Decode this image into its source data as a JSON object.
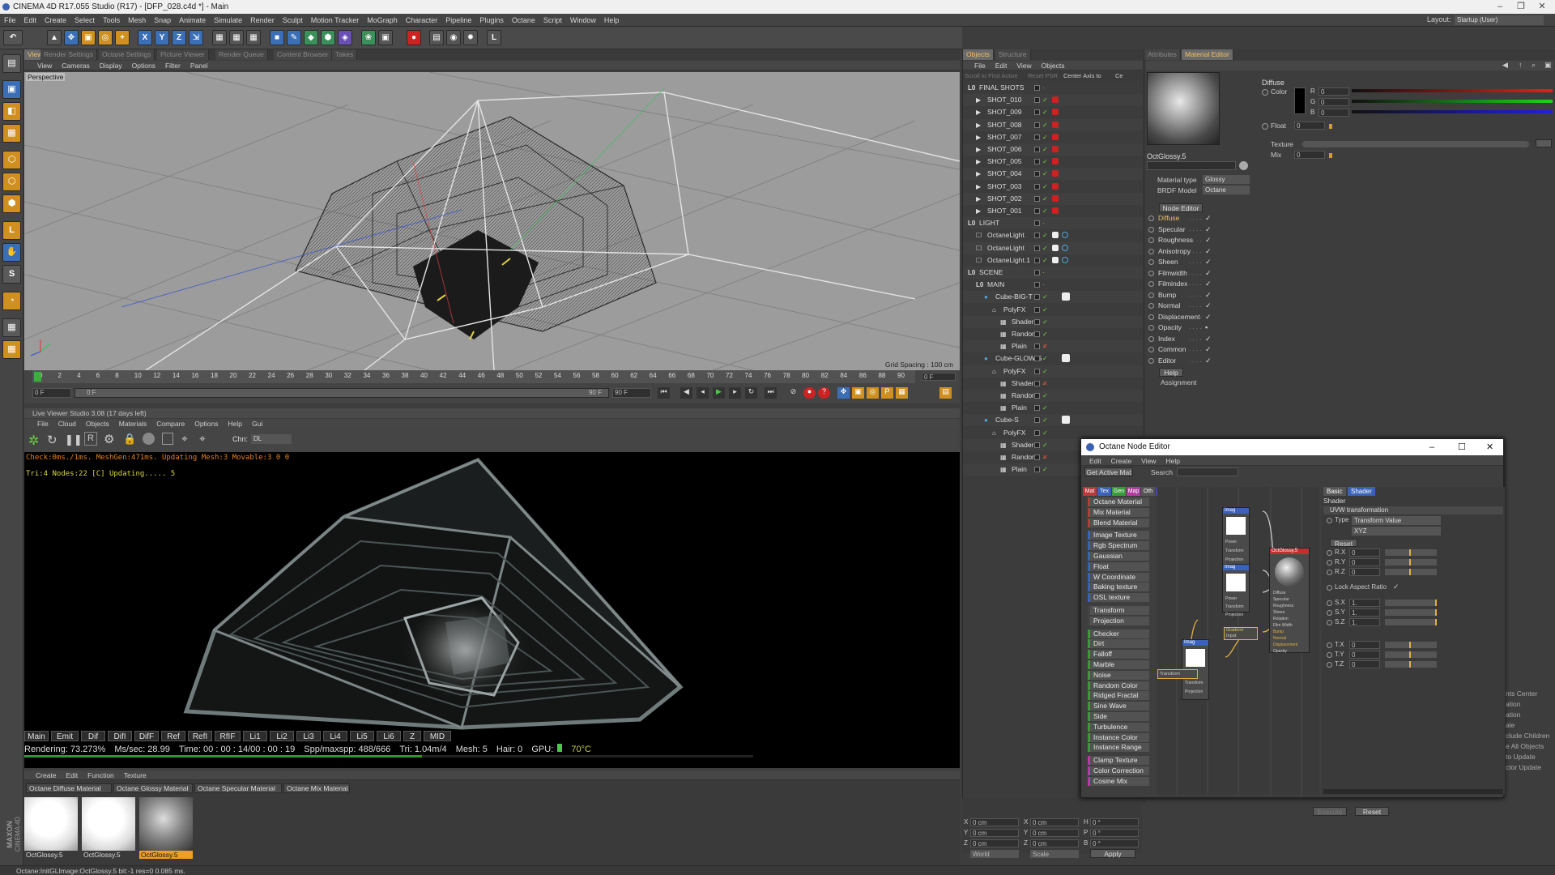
{
  "window": {
    "title": "CINEMA 4D R17.055 Studio (R17) - [DFP_028.c4d *] - Main",
    "layout_label": "Layout:",
    "layout_value": "Startup (User)"
  },
  "menu": [
    "File",
    "Edit",
    "Create",
    "Select",
    "Tools",
    "Mesh",
    "Snap",
    "Animate",
    "Simulate",
    "Render",
    "Sculpt",
    "Motion Tracker",
    "MoGraph",
    "Character",
    "Pipeline",
    "Plugins",
    "Octane",
    "Script",
    "Window",
    "Help"
  ],
  "toolbar": {
    "x_label": "X",
    "y_label": "Y",
    "z_label": "Z"
  },
  "editor_tabs": [
    "View",
    "Render Settings",
    "Octane Settings",
    "Picture Viewer",
    "Render Queue",
    "Content Browser",
    "Takes"
  ],
  "viewport": {
    "menu": [
      "View",
      "Cameras",
      "Display",
      "Options",
      "Filter",
      "Panel"
    ],
    "label": "Perspective",
    "grid_spacing": "Grid Spacing : 100 cm"
  },
  "timeline": {
    "ticks": [
      "0",
      "2",
      "4",
      "6",
      "8",
      "10",
      "12",
      "14",
      "16",
      "18",
      "20",
      "22",
      "24",
      "26",
      "28",
      "30",
      "32",
      "34",
      "36",
      "38",
      "40",
      "42",
      "44",
      "46",
      "48",
      "50",
      "52",
      "54",
      "56",
      "58",
      "60",
      "62",
      "64",
      "66",
      "68",
      "70",
      "72",
      "74",
      "76",
      "78",
      "80",
      "82",
      "84",
      "86",
      "88",
      "90"
    ],
    "current": "0 F",
    "start": "0 F",
    "end": "90 F",
    "end2": "90 F",
    "frame_right": "0 F",
    "slider_label": "0 F"
  },
  "live_viewer": {
    "title": "Live Viewer Studio 3.08 (17 days left)",
    "menu": [
      "File",
      "Cloud",
      "Objects",
      "Materials",
      "Compare",
      "Options",
      "Help",
      "Gui"
    ],
    "chn_label": "Chn:",
    "chn_value": "DL",
    "status1": "Check:0ms./1ms. MeshGen:471ms. Updating Mesh:3 Movable:3  0 0",
    "status2": "Tri:4 Nodes:22 [C] Updating.....   5",
    "passes": [
      "Main",
      "Emit",
      "Dif",
      "DifI",
      "DifF",
      "Ref",
      "RefI",
      "RfIF",
      "Li1",
      "Li2",
      "Li3",
      "Li4",
      "Li5",
      "Li6",
      "Z",
      "MID"
    ],
    "rendering": "Rendering: 73.273%",
    "ms_sec": "Ms/sec: 28.99",
    "time": "Time: 00 : 00 : 14/00 : 00 : 19",
    "spp": "Spp/maxspp: 488/666",
    "tri": "Tri: 1.04m/4",
    "mesh": "Mesh: 5",
    "hair": "Hair: 0",
    "gpu": "GPU:",
    "temp": "70°C",
    "progress": 73.273
  },
  "material_manager": {
    "menu": [
      "Create",
      "Edit",
      "Function",
      "Texture"
    ],
    "filters": [
      "Octane Diffuse Material",
      "Octane Glossy Material",
      "Octane Specular Material",
      "Octane Mix Material"
    ],
    "materials": [
      "OctGlossy.5",
      "OctGlossy.5",
      "OctGlossy.5"
    ]
  },
  "status_bar": "Octane:InitGLImage:OctGlossy.5  bit:-1 res=0  0.085 ms.",
  "maxon": {
    "line1": "MAXON",
    "line2": "CINEMA 4D"
  },
  "objects_panel": {
    "tabs": [
      "Objects",
      "Structure"
    ],
    "menu": [
      "File",
      "Edit",
      "View",
      "Objects"
    ],
    "sub_buttons": [
      "Scroll to First Active",
      "Reset PSR",
      "Center Axis to",
      "Ce"
    ],
    "items": [
      {
        "name": "FINAL SHOTS",
        "depth": 0,
        "type": "null"
      },
      {
        "name": "SHOT_010",
        "depth": 1,
        "type": "cam"
      },
      {
        "name": "SHOT_009",
        "depth": 1,
        "type": "cam"
      },
      {
        "name": "SHOT_008",
        "depth": 1,
        "type": "cam"
      },
      {
        "name": "SHOT_007",
        "depth": 1,
        "type": "cam"
      },
      {
        "name": "SHOT_006",
        "depth": 1,
        "type": "cam"
      },
      {
        "name": "SHOT_005",
        "depth": 1,
        "type": "cam"
      },
      {
        "name": "SHOT_004",
        "depth": 1,
        "type": "cam"
      },
      {
        "name": "SHOT_003",
        "depth": 1,
        "type": "cam"
      },
      {
        "name": "SHOT_002",
        "depth": 1,
        "type": "cam"
      },
      {
        "name": "SHOT_001",
        "depth": 1,
        "type": "cam"
      },
      {
        "name": "LIGHT",
        "depth": 0,
        "type": "null"
      },
      {
        "name": "OctaneLight",
        "depth": 1,
        "type": "light"
      },
      {
        "name": "OctaneLight",
        "depth": 1,
        "type": "light"
      },
      {
        "name": "OctaneLight.1",
        "depth": 1,
        "type": "light"
      },
      {
        "name": "SCENE",
        "depth": 0,
        "type": "null"
      },
      {
        "name": "MAIN",
        "depth": 1,
        "type": "null"
      },
      {
        "name": "Cube-BIG-T",
        "depth": 2,
        "type": "cube"
      },
      {
        "name": "PolyFX",
        "depth": 3,
        "type": "fx"
      },
      {
        "name": "Shader",
        "depth": 4,
        "type": "eff"
      },
      {
        "name": "Random",
        "depth": 4,
        "type": "eff"
      },
      {
        "name": "Plain",
        "depth": 4,
        "type": "eff"
      },
      {
        "name": "Cube-GLOW-S",
        "depth": 2,
        "type": "cube"
      },
      {
        "name": "PolyFX",
        "depth": 3,
        "type": "fx"
      },
      {
        "name": "Shader",
        "depth": 4,
        "type": "eff"
      },
      {
        "name": "Random",
        "depth": 4,
        "type": "eff"
      },
      {
        "name": "Plain",
        "depth": 4,
        "type": "eff"
      },
      {
        "name": "Cube-S",
        "depth": 2,
        "type": "cube"
      },
      {
        "name": "PolyFX",
        "depth": 3,
        "type": "fx"
      },
      {
        "name": "Shader",
        "depth": 4,
        "type": "eff"
      },
      {
        "name": "Random",
        "depth": 4,
        "type": "eff"
      },
      {
        "name": "Plain",
        "depth": 4,
        "type": "eff"
      }
    ]
  },
  "coordinates": {
    "labels": [
      "X",
      "Y",
      "Z",
      "X",
      "Y",
      "Z",
      "H",
      "P",
      "B"
    ],
    "values": [
      "0 cm",
      "0 cm",
      "0 cm",
      "0 cm",
      "0 cm",
      "0 cm",
      "0 °",
      "0 °",
      "0 °"
    ],
    "world": "World",
    "scale": "Scale",
    "apply": "Apply"
  },
  "attributes": {
    "tabs": [
      "Attributes",
      "Material Editor"
    ],
    "mat_name": "OctGlossy.5",
    "material_type_label": "Material type",
    "material_type": "Glossy",
    "brdf_label": "BRDF Model",
    "brdf": "Octane",
    "node_editor_btn": "Node Editor",
    "channels": [
      "Diffuse",
      "Specular",
      "Roughness",
      "Anisotropy",
      "Sheen",
      "Filmwidth",
      "Filmindex",
      "Bump",
      "Normal",
      "Displacement",
      "Opacity",
      "Index",
      "Common",
      "Editor"
    ],
    "help": "Help",
    "assignment": "Assignment",
    "section": "Diffuse",
    "color_label": "Color",
    "r_label": "R",
    "g_label": "G",
    "b_label": "B",
    "r_value": "0",
    "g_value": "0",
    "b_value": "0",
    "float_label": "Float",
    "float_value": "0",
    "texture_label": "Texture",
    "mix_label": "Mix",
    "mix_value": "0",
    "right_cut": [
      "nts Center",
      "ation",
      "ation",
      "ale",
      "clude Children",
      "e All Objects",
      "to Update",
      "ctor Update"
    ],
    "execute": "Execute",
    "reset": "Reset"
  },
  "node_editor": {
    "title": "Octane Node Editor",
    "menu": [
      "Edit",
      "Create",
      "View",
      "Help"
    ],
    "get_active": "Get Active Mat",
    "search_label": "Search",
    "cat_tabs": [
      "Mat",
      "Tex",
      "Gen",
      "Map",
      "Oth",
      "Ems",
      "Med",
      "C4D"
    ],
    "nodes": [
      {
        "name": "Octane Material",
        "color": "#b83a3a"
      },
      {
        "name": "Mix Material",
        "color": "#b83a3a"
      },
      {
        "name": "Blend Material",
        "color": "#b83a3a"
      },
      {
        "name": "Image Texture",
        "color": "#3a62b8"
      },
      {
        "name": "Rgb Spectrum",
        "color": "#3a62b8"
      },
      {
        "name": "Gaussian Spectrum",
        "color": "#3a62b8"
      },
      {
        "name": "Float",
        "color": "#3a62b8"
      },
      {
        "name": "W Coordinate",
        "color": "#3a62b8"
      },
      {
        "name": "Baking texture",
        "color": "#3a62b8"
      },
      {
        "name": "OSL texture",
        "color": "#3a62b8"
      },
      {
        "name": "Transform",
        "color": "#444444"
      },
      {
        "name": "Projection",
        "color": "#444444"
      },
      {
        "name": "Checker",
        "color": "#3a9a3a"
      },
      {
        "name": "Dirt",
        "color": "#3a9a3a"
      },
      {
        "name": "Falloff",
        "color": "#3a9a3a"
      },
      {
        "name": "Marble",
        "color": "#3a9a3a"
      },
      {
        "name": "Noise",
        "color": "#3a9a3a"
      },
      {
        "name": "Random Color",
        "color": "#3a9a3a"
      },
      {
        "name": "Ridged Fractal",
        "color": "#3a9a3a"
      },
      {
        "name": "Sine Wave",
        "color": "#3a9a3a"
      },
      {
        "name": "Side",
        "color": "#3a9a3a"
      },
      {
        "name": "Turbulence",
        "color": "#3a9a3a"
      },
      {
        "name": "Instance Color",
        "color": "#3a9a3a"
      },
      {
        "name": "Instance Range",
        "color": "#3a9a3a"
      },
      {
        "name": "Clamp Texture",
        "color": "#b83aa0"
      },
      {
        "name": "Color Correction",
        "color": "#b83aa0"
      },
      {
        "name": "Cosine Mix",
        "color": "#b83aa0"
      }
    ],
    "graph": {
      "img_label": "Imag",
      "img_ports": [
        "Power",
        "Transform",
        "Projection"
      ],
      "mat_label": "OctGlossy.5",
      "mat_ports": [
        "Diffuse",
        "Specular",
        "Roughness",
        "Sheen",
        "Rotation",
        "Film Width",
        "Bump",
        "Normal",
        "Displacement",
        "Opacity"
      ],
      "gradient_label": "Gradient",
      "input_label": "Input",
      "transform_label": "Transform"
    },
    "props": {
      "tabs": [
        "Basic",
        "Shader"
      ],
      "section": "Shader",
      "group": "UVW transformation",
      "type_label": "Type",
      "type_value": "Transform Value",
      "order": "XYZ",
      "reset": "Reset",
      "rows": [
        {
          "label": "R.X",
          "value": "0"
        },
        {
          "label": "R.Y",
          "value": "0"
        },
        {
          "label": "R.Z",
          "value": "0"
        },
        {
          "label": "S.X",
          "value": "1."
        },
        {
          "label": "S.Y",
          "value": "1."
        },
        {
          "label": "S.Z",
          "value": "1."
        },
        {
          "label": "T.X",
          "value": "0"
        },
        {
          "label": "T.Y",
          "value": "0"
        },
        {
          "label": "T.Z",
          "value": "0"
        }
      ],
      "lock_label": "Lock Aspect Ratio"
    }
  }
}
